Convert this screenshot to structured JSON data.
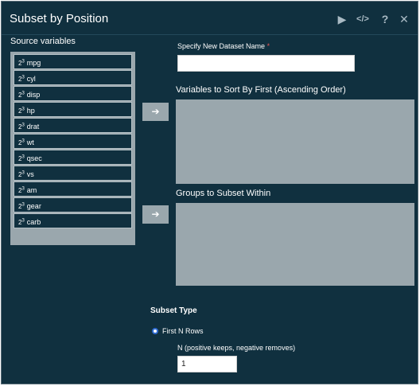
{
  "dialog": {
    "title": "Subset by Position",
    "header_icons": [
      "play-icon",
      "code-icon",
      "help-icon",
      "close-icon"
    ],
    "header_glyphs": {
      "run": "▶",
      "code": "</>",
      "help": "?",
      "close": "✕"
    }
  },
  "source": {
    "label": "Source variables",
    "type_prefix": "2",
    "type_sup": "3",
    "items": [
      "mpg",
      "cyl",
      "disp",
      "hp",
      "drat",
      "wt",
      "qsec",
      "vs",
      "am",
      "gear",
      "carb"
    ]
  },
  "arrow": "➔",
  "dataset_name": {
    "label": "Specify New Dataset Name",
    "required_mark": "*",
    "value": ""
  },
  "sort_vars": {
    "label": "Variables to Sort By First (Ascending Order)"
  },
  "groups": {
    "label": "Groups to Subset Within"
  },
  "subset_type": {
    "label": "Subset Type",
    "option": "First N Rows",
    "n_label": "N (positive keeps, negative removes)",
    "n_value": "1"
  },
  "colors": {
    "background": "#10303f",
    "panel_gray": "#9aa7ad",
    "radio_blue": "#2f6bd3"
  }
}
